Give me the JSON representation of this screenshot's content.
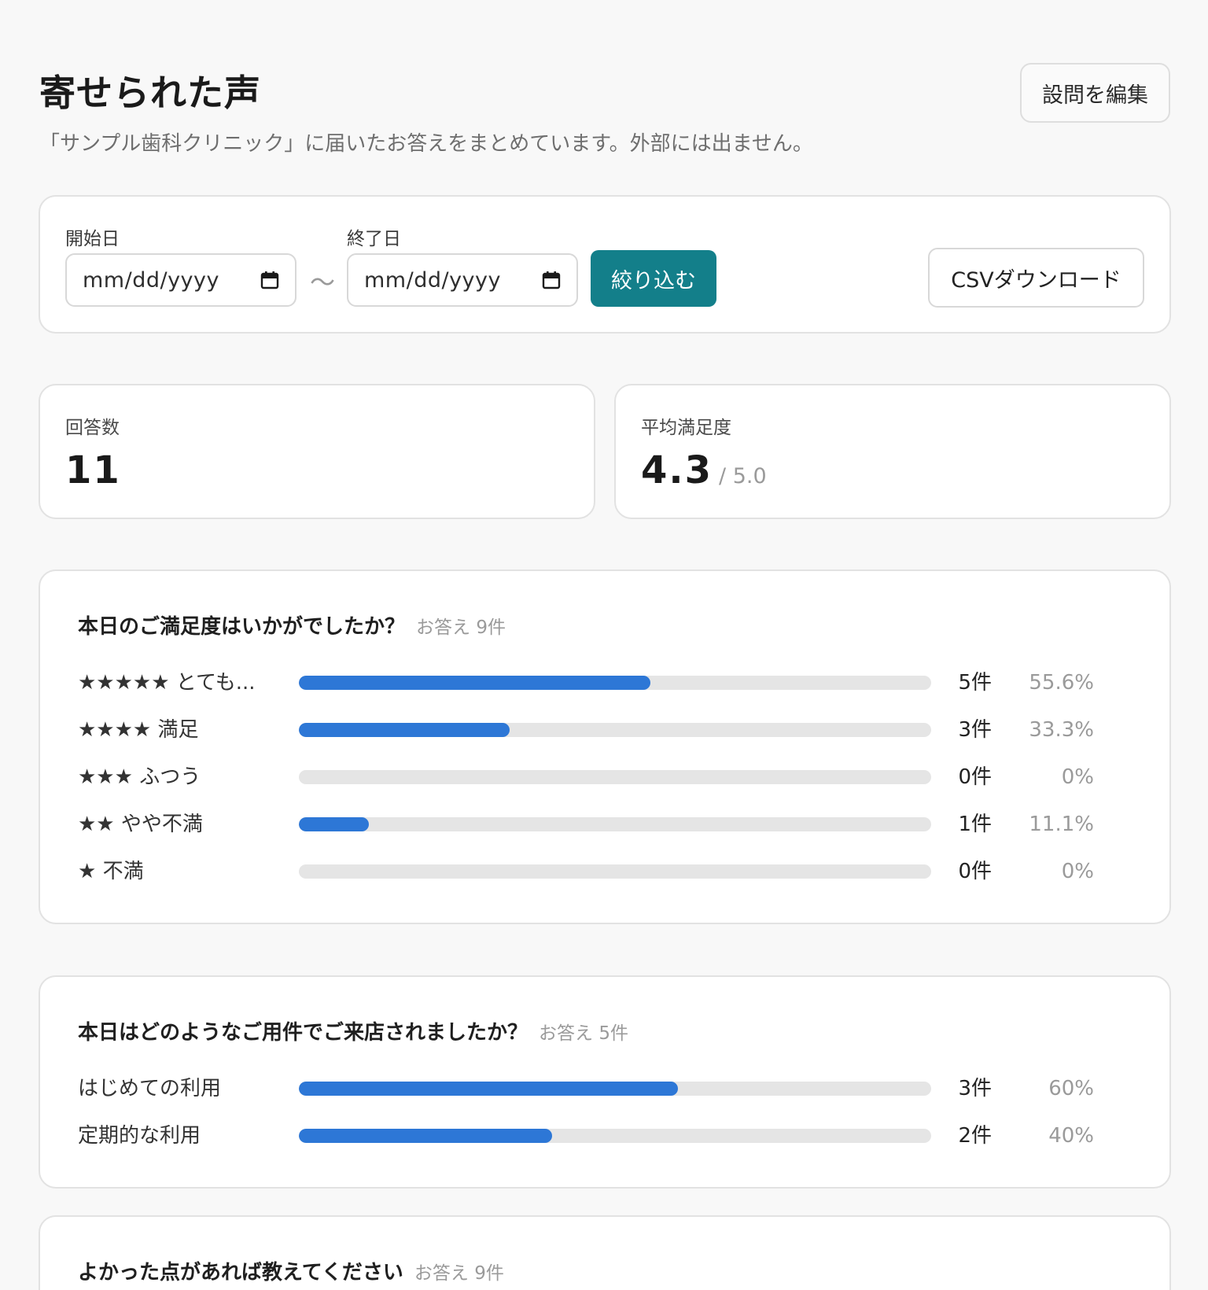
{
  "header": {
    "title": "寄せられた声",
    "subtitle": "「サンプル歯科クリニック」に届いたお答えをまとめています。外部には出ません。",
    "edit_button": "設問を編集"
  },
  "filter": {
    "start_label": "開始日",
    "end_label": "終了日",
    "start_placeholder": "mm/dd/yyyy",
    "end_placeholder": "mm/dd/yyyy",
    "separator": "〜",
    "apply_button": "絞り込む",
    "csv_button": "CSVダウンロード"
  },
  "stats": {
    "responses_label": "回答数",
    "responses_value": "11",
    "avg_label": "平均満足度",
    "avg_value": "4.3",
    "avg_suffix": "/ 5.0"
  },
  "questions": [
    {
      "title": "本日のご満足度はいかがでしたか？",
      "count": "お答え 9件",
      "rows": [
        {
          "label": "★★★★★ とても...",
          "count": "5件",
          "pct": "55.6%",
          "ratio": 0.556
        },
        {
          "label": "★★★★ 満足",
          "count": "3件",
          "pct": "33.3%",
          "ratio": 0.333
        },
        {
          "label": "★★★ ふつう",
          "count": "0件",
          "pct": "0%",
          "ratio": 0
        },
        {
          "label": "★★ やや不満",
          "count": "1件",
          "pct": "11.1%",
          "ratio": 0.111
        },
        {
          "label": "★ 不満",
          "count": "0件",
          "pct": "0%",
          "ratio": 0
        }
      ]
    },
    {
      "title": "本日はどのようなご用件でご来店されましたか？",
      "count": "お答え 5件",
      "rows": [
        {
          "label": "はじめての利用",
          "count": "3件",
          "pct": "60%",
          "ratio": 0.6
        },
        {
          "label": "定期的な利用",
          "count": "2件",
          "pct": "40%",
          "ratio": 0.4
        }
      ]
    },
    {
      "title": "よかった点があれば教えてください",
      "count": "お答え 9件",
      "rows": []
    }
  ],
  "colors": {
    "accent": "#137f8a",
    "bar": "#2d77d6",
    "track": "#e5e5e5"
  }
}
